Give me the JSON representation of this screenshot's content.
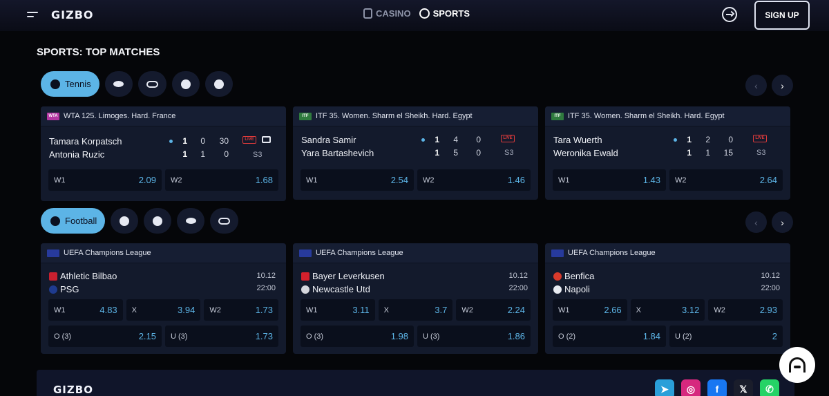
{
  "header": {
    "logo": "GIZBO",
    "nav": [
      {
        "label": "CASINO",
        "icon": "casino-icon"
      },
      {
        "label": "SPORTS",
        "icon": "football-icon"
      }
    ],
    "signup_label": "SIGN UP"
  },
  "section_title": "SPORTS: TOP MATCHES",
  "tennis": {
    "active_chip": "Tennis",
    "other_chips": [
      "hockey-icon",
      "esports-icon",
      "volleyball-icon",
      "football-icon"
    ],
    "cards": [
      {
        "tournament": "WTA 125. Limoges. Hard. France",
        "flag_text": "WTA",
        "team1": "Tamara Korpatsch",
        "team2": "Antonia Ruzic",
        "scores1": [
          "1",
          "0",
          "30"
        ],
        "scores2": [
          "1",
          "1",
          "0"
        ],
        "set": "S3",
        "live": "LIVE",
        "tv": true,
        "odds": [
          {
            "label": "W1",
            "value": "2.09"
          },
          {
            "label": "W2",
            "value": "1.68"
          }
        ]
      },
      {
        "tournament": "ITF 35. Women. Sharm el Sheikh. Hard. Egypt",
        "flag_text": "ITF",
        "team1": "Sandra Samir",
        "team2": "Yara Bartashevich",
        "scores1": [
          "1",
          "4",
          "0"
        ],
        "scores2": [
          "1",
          "5",
          "0"
        ],
        "set": "S3",
        "live": "LIVE",
        "tv": false,
        "odds": [
          {
            "label": "W1",
            "value": "2.54"
          },
          {
            "label": "W2",
            "value": "1.46"
          }
        ]
      },
      {
        "tournament": "ITF 35. Women. Sharm el Sheikh. Hard. Egypt",
        "flag_text": "ITF",
        "team1": "Tara Wuerth",
        "team2": "Weronika Ewald",
        "scores1": [
          "1",
          "2",
          "0"
        ],
        "scores2": [
          "1",
          "1",
          "15"
        ],
        "set": "S3",
        "live": "LIVE",
        "tv": false,
        "odds": [
          {
            "label": "W1",
            "value": "1.43"
          },
          {
            "label": "W2",
            "value": "2.64"
          }
        ]
      }
    ]
  },
  "football": {
    "active_chip": "Football",
    "other_chips": [
      "tennis-icon",
      "basketball-icon",
      "hockey-icon",
      "esports-icon"
    ],
    "cards": [
      {
        "tournament": "UEFA Champions League",
        "team1": "Athletic Bilbao",
        "team2": "PSG",
        "date": "10.12",
        "time": "22:00",
        "odds1": [
          {
            "label": "W1",
            "value": "4.83"
          },
          {
            "label": "X",
            "value": "3.94"
          },
          {
            "label": "W2",
            "value": "1.73"
          }
        ],
        "odds2": [
          {
            "label": "O (3)",
            "value": "2.15"
          },
          {
            "label": "U (3)",
            "value": "1.73"
          }
        ]
      },
      {
        "tournament": "UEFA Champions League",
        "team1": "Bayer Leverkusen",
        "team2": "Newcastle Utd",
        "date": "10.12",
        "time": "22:00",
        "odds1": [
          {
            "label": "W1",
            "value": "3.11"
          },
          {
            "label": "X",
            "value": "3.7"
          },
          {
            "label": "W2",
            "value": "2.24"
          }
        ],
        "odds2": [
          {
            "label": "O (3)",
            "value": "1.98"
          },
          {
            "label": "U (3)",
            "value": "1.86"
          }
        ]
      },
      {
        "tournament": "UEFA Champions League",
        "team1": "Benfica",
        "team2": "Napoli",
        "date": "10.12",
        "time": "22:00",
        "odds1": [
          {
            "label": "W1",
            "value": "2.66"
          },
          {
            "label": "X",
            "value": "3.12"
          },
          {
            "label": "W2",
            "value": "2.93"
          }
        ],
        "odds2": [
          {
            "label": "O (2)",
            "value": "1.84"
          },
          {
            "label": "U (2)",
            "value": "2"
          }
        ]
      }
    ]
  },
  "footer": {
    "logo": "GIZBO",
    "socials": [
      {
        "name": "telegram-icon",
        "glyph": "➤",
        "color": "#2a9fd9"
      },
      {
        "name": "instagram-icon",
        "glyph": "◎",
        "color": "#d6287e"
      },
      {
        "name": "facebook-icon",
        "glyph": "f",
        "color": "#1877f2"
      },
      {
        "name": "x-icon",
        "glyph": "𝕏",
        "color": "#1a1d2b"
      },
      {
        "name": "whatsapp-icon",
        "glyph": "✆",
        "color": "#25d366"
      }
    ]
  },
  "colors": {
    "accent": "#5cb4e6",
    "live": "#e03b3b",
    "card": "#131a2c"
  }
}
